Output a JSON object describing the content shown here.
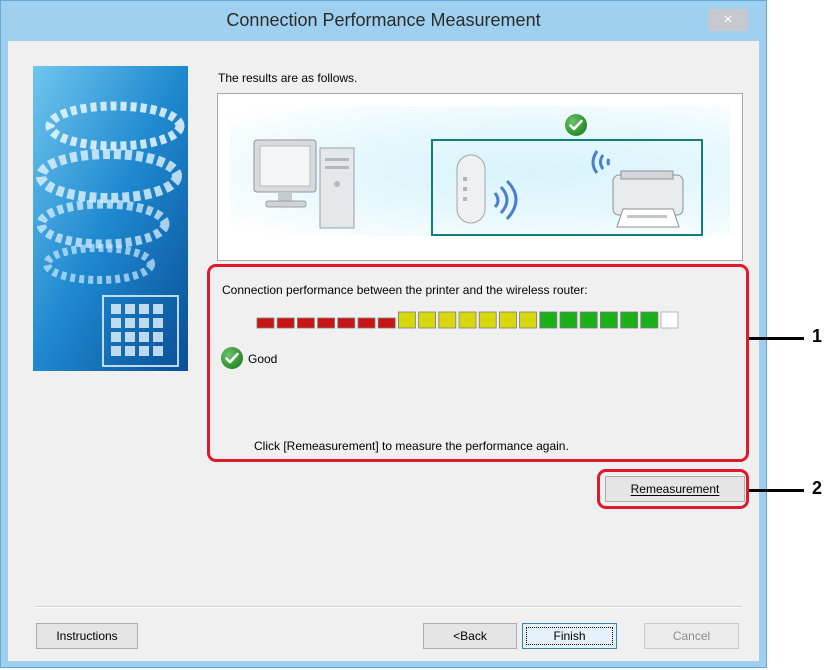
{
  "window": {
    "title": "Connection Performance Measurement",
    "close_glyph": "×"
  },
  "main": {
    "results_label": "The results are as follows.",
    "performance_label": "Connection performance between the printer and the wireless router:",
    "signal_level": 0.95,
    "status": "Good",
    "hint": "Click [Remeasurement] to measure the performance again."
  },
  "buttons": {
    "remeasurement": "Remeasurement",
    "instructions": "Instructions",
    "back": "<Back",
    "finish": "Finish",
    "cancel": "Cancel"
  },
  "callouts": {
    "one": "1",
    "two": "2"
  },
  "icons": {
    "status": "check-icon",
    "computer": "computer-icon",
    "router": "wireless-router-icon",
    "printer": "printer-icon"
  },
  "colors": {
    "callout_border": "#e0192b",
    "check_green": "#2a8a2a",
    "bar_low": "#c81414",
    "bar_mid": "#d7d80e",
    "bar_high": "#19b019",
    "router_frame": "#0f7f7b"
  }
}
